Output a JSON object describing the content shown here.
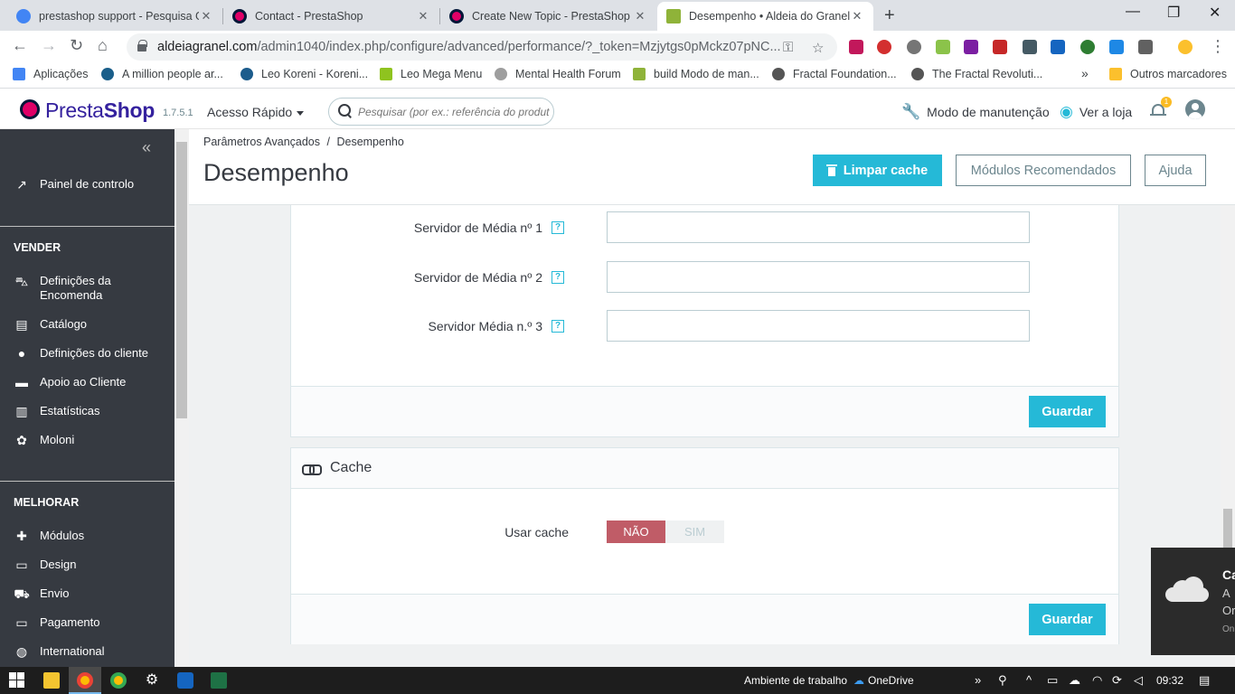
{
  "browser": {
    "tabs": [
      {
        "title": "prestashop support - Pesquisa G",
        "favicon_color": "#4285f4",
        "active": false
      },
      {
        "title": "Contact - PrestaShop",
        "favicon_color": "#df0067",
        "active": false
      },
      {
        "title": "Create New Topic - PrestaShop F",
        "favicon_color": "#df0067",
        "active": false
      },
      {
        "title": "Desempenho • Aldeia do Granel",
        "favicon_color": "#8fb339",
        "active": true
      }
    ],
    "url_host": "aldeiagranel.com",
    "url_path": "/admin1040/index.php/configure/advanced/performance/?_token=Mzjytgs0pMckz07pNC...",
    "bookmarks": [
      {
        "label": "Aplicações",
        "color": "#4285f4"
      },
      {
        "label": "A million people ar...",
        "color": "#1a5e8a"
      },
      {
        "label": "Leo Koreni - Koreni...",
        "color": "#1c5c8c"
      },
      {
        "label": "Leo Mega Menu",
        "color": "#8fc31f"
      },
      {
        "label": "Mental Health Forum",
        "color": "#9e9e9e"
      },
      {
        "label": "build Modo de man...",
        "color": "#8fb339"
      },
      {
        "label": "Fractal Foundation...",
        "color": "#555555"
      },
      {
        "label": "The Fractal Revoluti...",
        "color": "#555555"
      }
    ],
    "bookmarks_overflow": "»",
    "other_bookmarks": "Outros marcadores"
  },
  "header": {
    "brand_prefix": "Presta",
    "brand_suffix": "Shop",
    "version": "1.7.5.1",
    "quick_access": "Acesso Rápido",
    "search_placeholder": "Pesquisar (por ex.: referência do produt",
    "maintenance": "Modo de manutenção",
    "view_store": "Ver a loja",
    "notifications_count": "1"
  },
  "sidebar": {
    "collapse": "«",
    "dashboard": "Painel de controlo",
    "section_sell": "VENDER",
    "sell_items": [
      {
        "label": "Definições da Encomenda",
        "icon": "basket-icon"
      },
      {
        "label": "Catálogo",
        "icon": "store-icon"
      },
      {
        "label": "Definições do cliente",
        "icon": "account-icon"
      },
      {
        "label": "Apoio ao Cliente",
        "icon": "chat-icon"
      },
      {
        "label": "Estatísticas",
        "icon": "bar-chart-icon"
      },
      {
        "label": "Moloni",
        "icon": "lotus-icon"
      }
    ],
    "section_improve": "MELHORAR",
    "improve_items": [
      {
        "label": "Módulos",
        "icon": "puzzle-icon"
      },
      {
        "label": "Design",
        "icon": "desktop-icon"
      },
      {
        "label": "Envio",
        "icon": "truck-icon"
      },
      {
        "label": "Pagamento",
        "icon": "credit-card-icon"
      },
      {
        "label": "International",
        "icon": "globe-icon"
      }
    ]
  },
  "page": {
    "breadcrumb_parent": "Parâmetros Avançados",
    "breadcrumb_sep": "/",
    "breadcrumb_current": "Desempenho",
    "title": "Desempenho",
    "clear_cache": "Limpar cache",
    "recommended_modules": "Módulos Recomendados",
    "help": "Ajuda"
  },
  "media_servers": {
    "fields": [
      {
        "label": "Servidor de Média nº 1",
        "value": ""
      },
      {
        "label": "Servidor de Média nº 2",
        "value": ""
      },
      {
        "label": "Servidor Média n.º 3",
        "value": ""
      }
    ],
    "help_glyph": "?",
    "save": "Guardar"
  },
  "cache": {
    "heading": "Cache",
    "use_cache_label": "Usar cache",
    "option_no": "NÃO",
    "option_yes": "SIM",
    "selected": "NÃO",
    "save": "Guardar"
  },
  "toast": {
    "title": "Ca",
    "line1": "A",
    "line2": "Or",
    "line3": "On"
  },
  "taskbar": {
    "desktop_label": "Ambiente de trabalho",
    "onedrive": "OneDrive",
    "time": "09:32"
  },
  "colors": {
    "primary": "#25b9d7",
    "sidebar": "#363a41",
    "switch_off": "#c05c67"
  }
}
